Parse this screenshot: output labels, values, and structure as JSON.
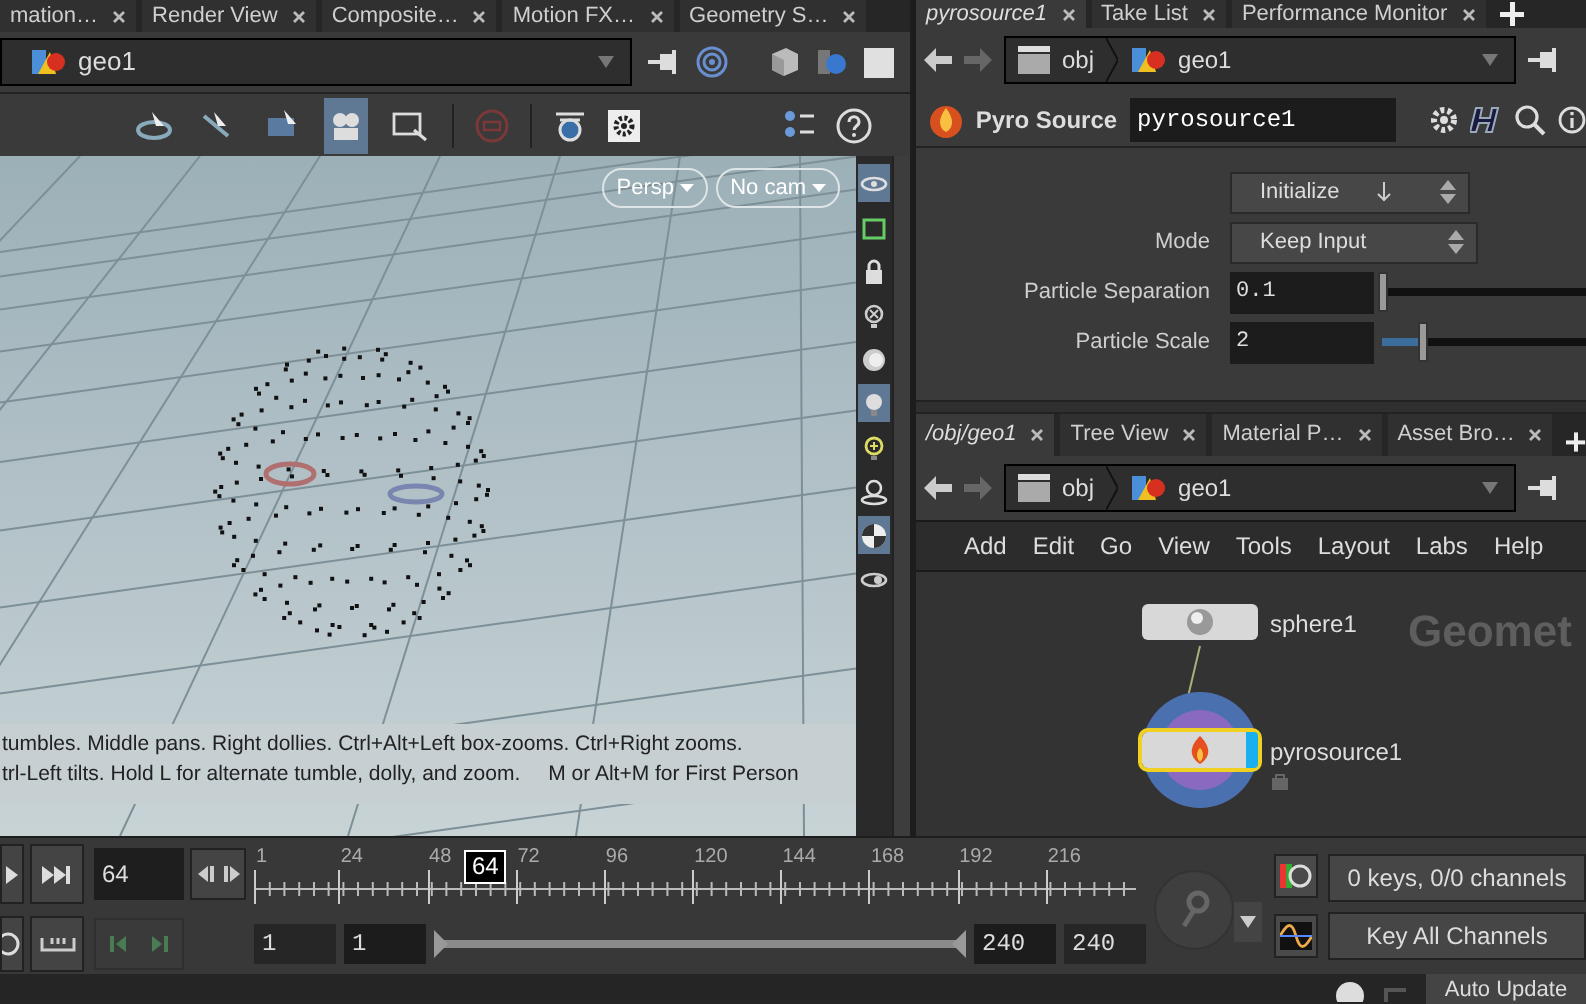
{
  "viewer_tabs": [
    {
      "label": "mation…",
      "selected": false
    },
    {
      "label": "Render View",
      "selected": false
    },
    {
      "label": "Composite…",
      "selected": false
    },
    {
      "label": "Motion FX…",
      "selected": false
    },
    {
      "label": "Geometry S…",
      "selected": false
    }
  ],
  "viewer_path": "geo1",
  "view_tools": [
    {
      "selected": false
    },
    {
      "selected": false
    },
    {
      "selected": false
    },
    {
      "selected": true
    },
    {
      "selected": false
    }
  ],
  "viewport": {
    "view_menu": "Persp",
    "camera_menu": "No cam",
    "help_lines": [
      "tumbles. Middle pans. Right dollies. Ctrl+Alt+Left box-zooms. Ctrl+Right zooms.",
      "trl-Left tilts. Hold L for alternate tumble, dolly, and zoom."
    ],
    "help_hint": "M or Alt+M for First Person"
  },
  "display_toggles": [
    {
      "on": true
    },
    {
      "on": false
    },
    {
      "on": false
    },
    {
      "on": false
    },
    {
      "on": false
    },
    {
      "on": true
    },
    {
      "on": false
    },
    {
      "on": false
    },
    {
      "on": true
    },
    {
      "on": false
    }
  ],
  "param_tabs": [
    {
      "label": "pyrosource1",
      "selected": true
    },
    {
      "label": "Take List",
      "selected": false
    },
    {
      "label": "Performance Monitor",
      "selected": false
    }
  ],
  "param_path": [
    "obj",
    "geo1"
  ],
  "node_header": {
    "type": "Pyro Source",
    "name": "pyrosource1"
  },
  "parameters": [
    {
      "kind": "button",
      "value": "Initialize"
    },
    {
      "kind": "menu",
      "label": "Mode",
      "value": "Keep Input"
    },
    {
      "kind": "slider",
      "label": "Particle Separation",
      "value": "0.1",
      "level": 0
    },
    {
      "kind": "slider",
      "label": "Particle Scale",
      "value": "2",
      "level": 0.2
    }
  ],
  "network_tabs": [
    {
      "label": "/obj/geo1",
      "selected": true
    },
    {
      "label": "Tree View",
      "selected": false
    },
    {
      "label": "Material P…",
      "selected": false
    },
    {
      "label": "Asset Bro…",
      "selected": false
    }
  ],
  "network_path": [
    "obj",
    "geo1"
  ],
  "network_menu": [
    "Add",
    "Edit",
    "Go",
    "View",
    "Tools",
    "Layout",
    "Labs",
    "Help"
  ],
  "network": {
    "context_label": "Geomet",
    "nodes": [
      {
        "name": "sphere1",
        "kind": "sphere",
        "selected": false
      },
      {
        "name": "pyrosource1",
        "kind": "pyro",
        "selected": true
      }
    ]
  },
  "timeline": {
    "frame": "64",
    "marker": "64",
    "level": 0.2636,
    "tick_labels": [
      "1",
      "24",
      "48",
      "72",
      "96",
      "120",
      "144",
      "168",
      "192",
      "216"
    ],
    "start": "1",
    "start_visible": "1",
    "end_visible": "240",
    "end": "240",
    "range_slider": {
      "level": 1
    }
  },
  "keys": {
    "status": "0 keys, 0/0 channels",
    "key_all": "Key All Channels"
  },
  "status_bar": {
    "auto_update": "Auto Update"
  }
}
